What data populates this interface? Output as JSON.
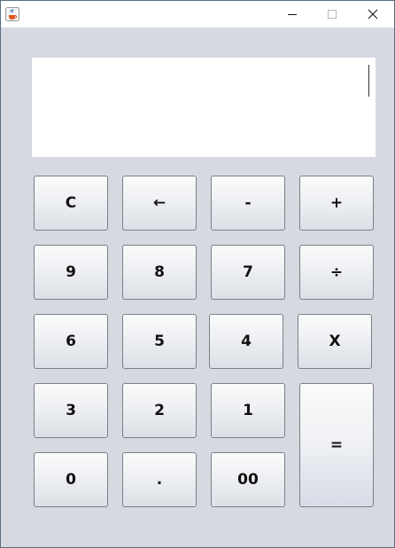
{
  "window": {
    "controls": {
      "minimize": "minimize-icon",
      "maximize": "maximize-icon",
      "close": "close-icon"
    },
    "app_icon": "java-cup-icon"
  },
  "display": {
    "value": ""
  },
  "keys": {
    "clear": "C",
    "backspace": "←",
    "minus": "-",
    "plus": "+",
    "nine": "9",
    "eight": "8",
    "seven": "7",
    "divide": "÷",
    "six": "6",
    "five": "5",
    "four": "4",
    "multiply": "X",
    "three": "3",
    "two": "2",
    "one": "1",
    "equals": "=",
    "zero": "0",
    "dot": ".",
    "double_zero": "00"
  },
  "colors": {
    "window_bg": "#d6d9e0",
    "display_bg": "#ffffff",
    "key_border": "#7a7f88"
  }
}
